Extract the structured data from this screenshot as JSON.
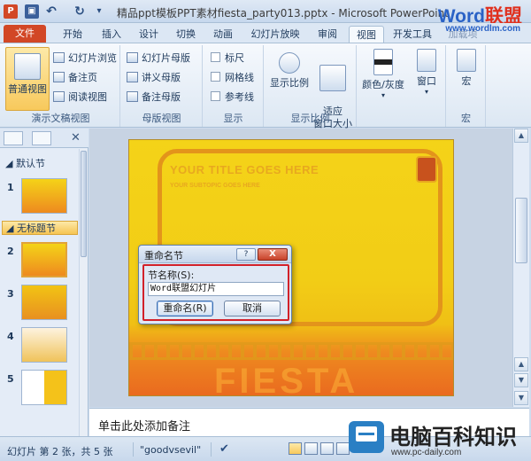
{
  "window": {
    "title": "精品ppt模板PPT素材fiesta_party013.pptx - Microsoft PowerPoint",
    "app_icon_letter": "P"
  },
  "brand": {
    "name_a": "Word",
    "name_b": "联盟",
    "url": "www.wordlm.com"
  },
  "tabs": [
    {
      "label": "文件"
    },
    {
      "label": "开始"
    },
    {
      "label": "插入"
    },
    {
      "label": "设计"
    },
    {
      "label": "切换"
    },
    {
      "label": "动画"
    },
    {
      "label": "幻灯片放映"
    },
    {
      "label": "审阅"
    },
    {
      "label": "视图"
    },
    {
      "label": "开发工具"
    },
    {
      "label": "加载项"
    }
  ],
  "ribbon": {
    "groups": [
      {
        "label": "演示文稿视图"
      },
      {
        "label": "母版视图"
      },
      {
        "label": "显示"
      },
      {
        "label": "显示比例"
      },
      {
        "label": "宏"
      }
    ],
    "normal_view": "普通视图",
    "slide_sorter": "幻灯片浏览",
    "notes_page": "备注页",
    "reading_view": "阅读视图",
    "slide_master": "幻灯片母版",
    "handout_master": "讲义母版",
    "notes_master": "备注母版",
    "ruler": "标尺",
    "gridlines": "网格线",
    "guides": "参考线",
    "zoom": "显示比例",
    "fit_window": "适应\n窗口大小",
    "color_grayscale": "颜色/灰度",
    "window": "窗口",
    "macros": "宏"
  },
  "left_pane": {
    "sections": [
      {
        "label": "默认节",
        "selected": false
      },
      {
        "label": "无标题节",
        "selected": true
      }
    ],
    "thumbnails": [
      {
        "num": "1"
      },
      {
        "num": "2"
      },
      {
        "num": "3"
      },
      {
        "num": "4"
      },
      {
        "num": "5"
      }
    ]
  },
  "slide": {
    "title": "YOUR TITLE GOES HERE",
    "subtitle": "YOUR SUBTOPIC GOES HERE",
    "watermark": "FIESTA"
  },
  "notes": {
    "placeholder": "单击此处添加备注"
  },
  "dialog": {
    "title": "重命名节",
    "help": "?",
    "close": "X",
    "label": "节名称(S):",
    "input_value": "Word联盟幻灯片",
    "rename_button": "重命名(R)",
    "cancel_button": "取消"
  },
  "status": {
    "slide_info": "幻灯片 第 2 张，共 5 张",
    "theme": "\"goodvsevil\""
  },
  "logo": {
    "title": "电脑百科知识",
    "url": "www.pc-daily.com"
  },
  "colors": {
    "file_tab": "#d24726",
    "accent_selected": "#f8c95c",
    "slide_yellow": "#f2cd16",
    "slide_orange": "#ea6a1f",
    "dialog_highlight": "#d2212a"
  }
}
